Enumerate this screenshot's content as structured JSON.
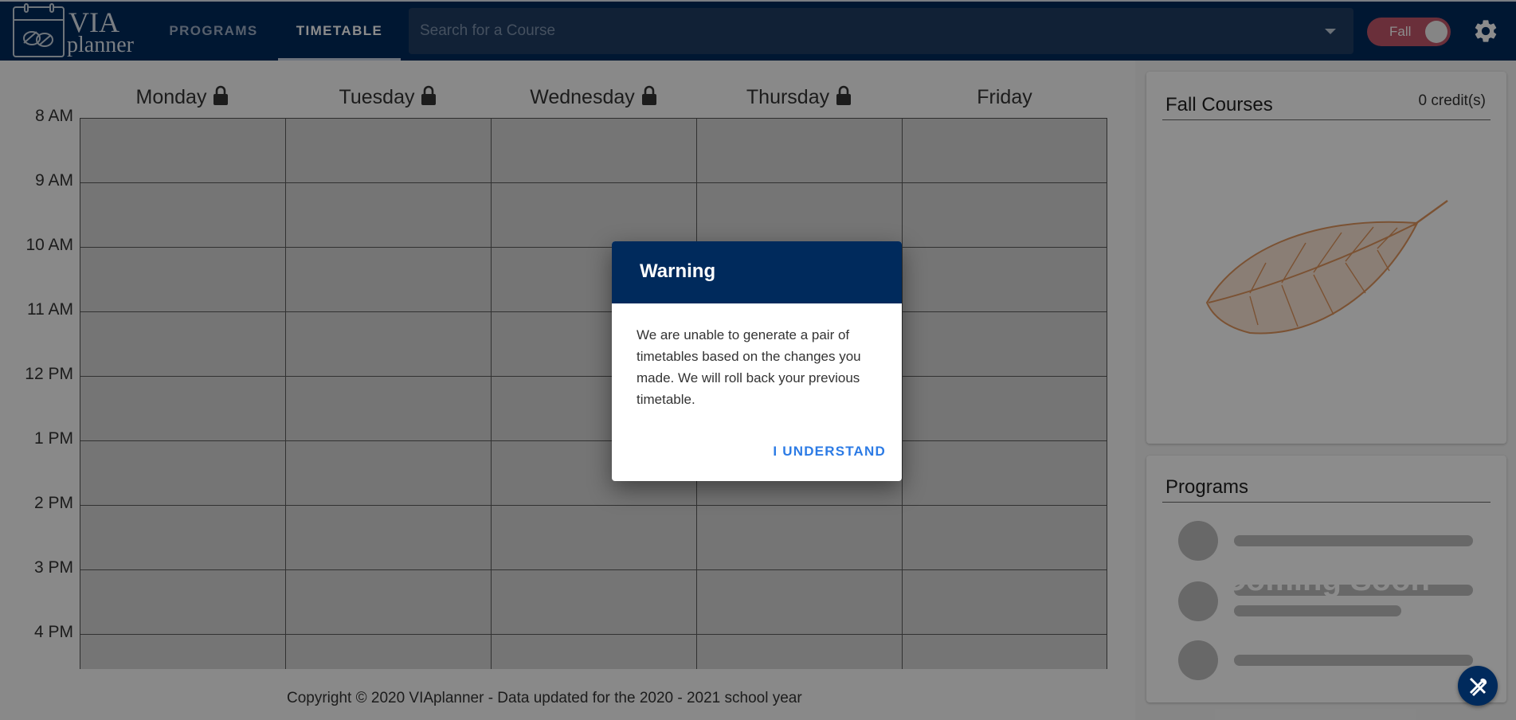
{
  "app": {
    "logo_title": "VIA",
    "logo_subtitle": "planner"
  },
  "nav": {
    "tabs": [
      {
        "label": "PROGRAMS",
        "active": false
      },
      {
        "label": "TIMETABLE",
        "active": true
      }
    ]
  },
  "search": {
    "placeholder": "Search for a Course",
    "value": ""
  },
  "term_toggle": {
    "label": "Fall"
  },
  "icons": {
    "settings": "gear-icon",
    "lock": "lock-icon",
    "search_dropdown": "chevron-down-icon",
    "leaf": "leaf-illustration",
    "tools": "tools-icon"
  },
  "timetable": {
    "days": [
      {
        "name": "Monday",
        "locked": true
      },
      {
        "name": "Tuesday",
        "locked": true
      },
      {
        "name": "Wednesday",
        "locked": true
      },
      {
        "name": "Thursday",
        "locked": true
      },
      {
        "name": "Friday",
        "locked": false
      }
    ],
    "times": [
      "8 AM",
      "9 AM",
      "10 AM",
      "11 AM",
      "12 PM",
      "1 PM",
      "2 PM",
      "3 PM",
      "4 PM"
    ]
  },
  "footer": {
    "copyright": "Copyright © 2020 VIAplanner - Data updated for the 2020 - 2021 school year"
  },
  "side": {
    "courses_card": {
      "title": "Fall Courses",
      "credits": "0 credit(s)"
    },
    "programs_card": {
      "title": "Programs",
      "overlay_text": "Coming Soon"
    }
  },
  "dialog": {
    "title": "Warning",
    "message": "We are unable to generate a pair of timetables based on the changes you made. We will roll back your previous timetable.",
    "button": "I UNDERSTAND"
  },
  "colors": {
    "primary": "#002a5c",
    "accent_link": "#2c7be5",
    "toggle": "#c2576b",
    "leaf": "#e0955e"
  }
}
